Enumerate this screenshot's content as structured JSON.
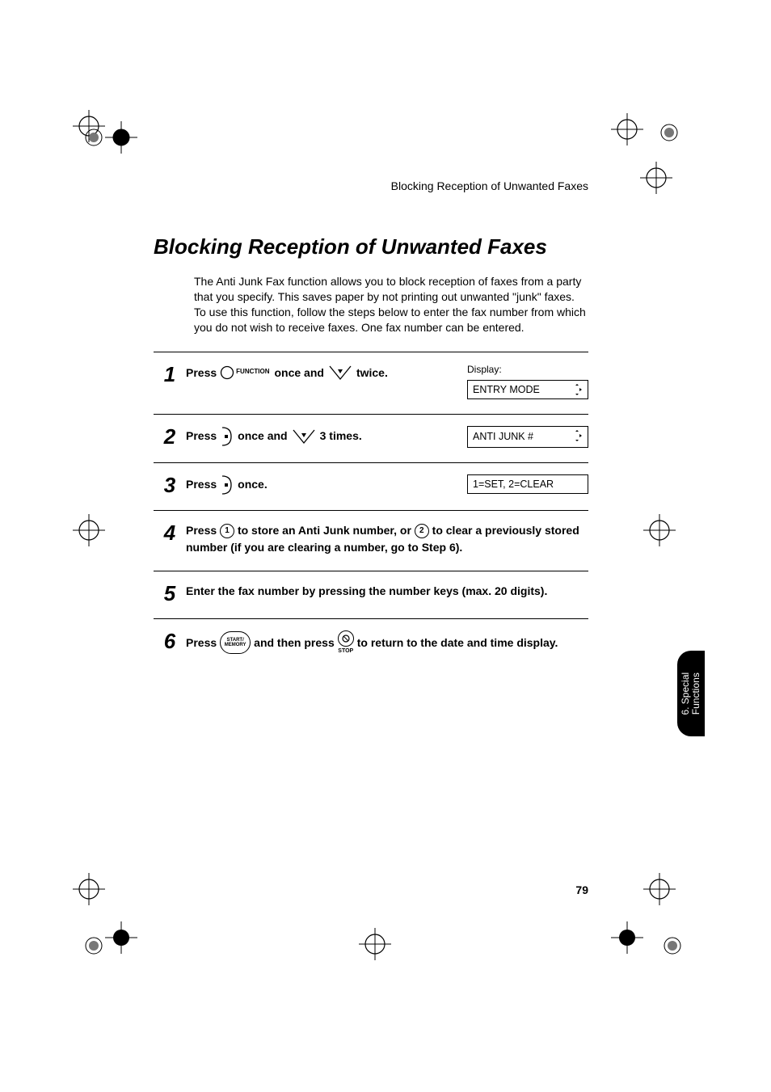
{
  "header": "Blocking Reception of Unwanted Faxes",
  "title": "Blocking Reception of Unwanted Faxes",
  "intro": "The Anti Junk Fax function allows you to block reception of faxes from a party that you specify. This saves paper by not printing out unwanted \"junk\" faxes. To use this function, follow the steps below to enter the fax number from which you do not wish to receive faxes. One fax number can be entered.",
  "display_label": "Display:",
  "steps": {
    "s1": {
      "num": "1",
      "press": "Press",
      "function": "FUNCTION",
      "once_and": "once and",
      "twice": "twice.",
      "display": "ENTRY MODE"
    },
    "s2": {
      "num": "2",
      "press": "Press",
      "once_and": "once and",
      "three_times": "3 times.",
      "display": "ANTI JUNK #"
    },
    "s3": {
      "num": "3",
      "press": "Press",
      "once": "once.",
      "display": "1=SET, 2=CLEAR"
    },
    "s4": {
      "num": "4",
      "press": "Press",
      "key1": "1",
      "mid": "to store an Anti Junk number, or",
      "key2": "2",
      "tail": "to clear a previously stored number (if you are clearing a number, go to Step 6)."
    },
    "s5": {
      "num": "5",
      "text": "Enter the fax number by pressing the number keys (max. 20 digits)."
    },
    "s6": {
      "num": "6",
      "press": "Press",
      "start_memory": "START/\nMEMORY",
      "and_then_press": "and then press",
      "stop": "STOP",
      "tail": "to return to the date and time display."
    }
  },
  "tab": "6. Special\nFunctions",
  "page_number": "79"
}
